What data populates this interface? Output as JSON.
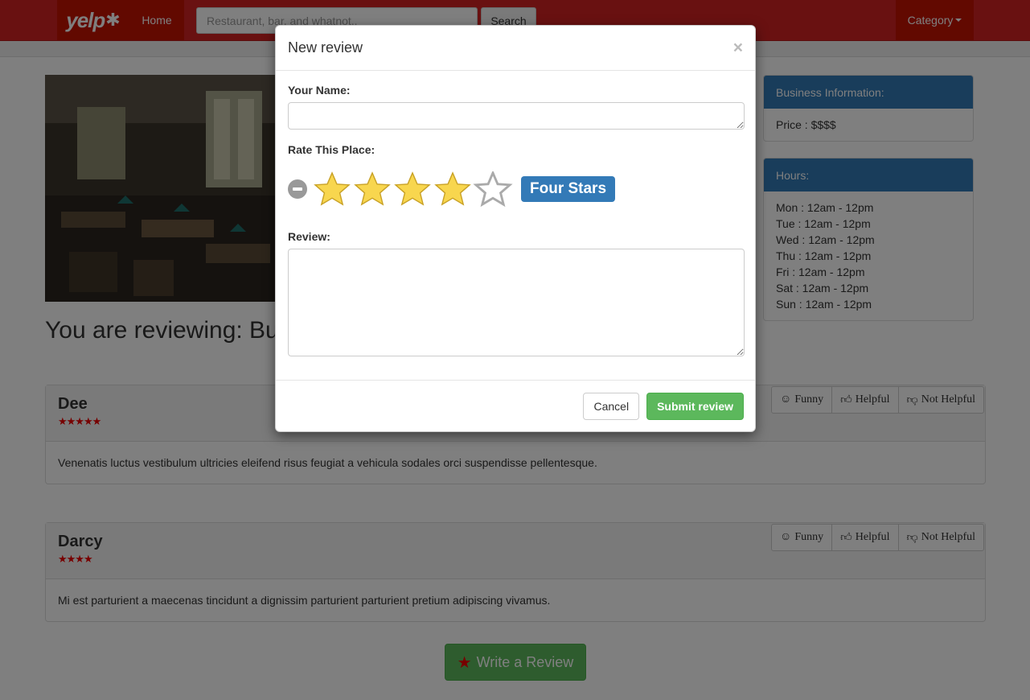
{
  "navbar": {
    "logo_text": "yelp",
    "home_label": "Home",
    "search_placeholder": "Restaurant, bar, and whatnot..",
    "search_button": "Search",
    "category_label": "Category"
  },
  "page": {
    "heading": "You are reviewing: Bu"
  },
  "business_info": {
    "title": "Business Information:",
    "price": "Price : $$$$"
  },
  "hours": {
    "title": "Hours:",
    "rows": [
      "Mon : 12am - 12pm",
      "Tue : 12am - 12pm",
      "Wed : 12am - 12pm",
      "Thu : 12am - 12pm",
      "Fri : 12am - 12pm",
      "Sat : 12am - 12pm",
      "Sun : 12am - 12pm"
    ]
  },
  "vote_labels": {
    "funny": "Funny",
    "helpful": "Helpful",
    "not_helpful": "Not Helpful"
  },
  "reviews": [
    {
      "name": "Dee",
      "stars": 5,
      "stars_text": "★★★★★",
      "text": "Venenatis luctus vestibulum ultricies eleifend risus feugiat a vehicula sodales orci suspendisse pellentesque."
    },
    {
      "name": "Darcy",
      "stars": 4,
      "stars_text": "★★★★",
      "text": "Mi est parturient a maecenas tincidunt a dignissim parturient parturient pretium adipiscing vivamus."
    }
  ],
  "write_review_button": "Write a Review",
  "modal": {
    "title": "New review",
    "close": "×",
    "name_label": "Your Name:",
    "name_value": "",
    "rate_label": "Rate This Place:",
    "rating_value": 4,
    "rating_max": 5,
    "rating_text": "Four Stars",
    "review_label": "Review:",
    "review_value": "",
    "cancel_label": "Cancel",
    "submit_label": "Submit review"
  },
  "colors": {
    "brand_red": "#d32323",
    "primary_blue": "#337ab7",
    "success_green": "#5cb85c",
    "star_yellow": "#f8d64e",
    "review_star_red": "#e00000"
  }
}
